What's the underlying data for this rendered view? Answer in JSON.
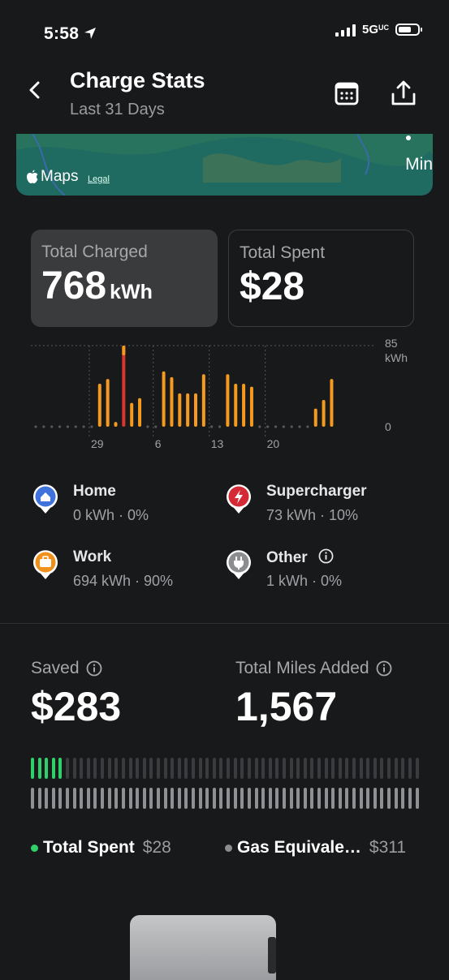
{
  "status_bar": {
    "time": "5:58",
    "network": "5G",
    "network_sup": "UC"
  },
  "header": {
    "title": "Charge Stats",
    "subtitle": "Last 31 Days"
  },
  "map": {
    "logo": "Maps",
    "legal": "Legal",
    "city_partial": "Min"
  },
  "stats": {
    "total_charged": {
      "label": "Total Charged",
      "value": "768",
      "unit": "kWh"
    },
    "total_spent": {
      "label": "Total Spent",
      "value": "$28"
    }
  },
  "chart_data": {
    "type": "bar",
    "ylabel": "kWh",
    "ylim": [
      0,
      85
    ],
    "y_ticks": [
      "85",
      "0"
    ],
    "y_top_unit": "kWh",
    "x_tick_labels": [
      "29",
      "6",
      "13",
      "20"
    ],
    "x_tick_indices": [
      7,
      15,
      22,
      29
    ],
    "values": [
      0,
      0,
      0,
      0,
      0,
      0,
      0,
      0,
      45,
      50,
      5,
      85,
      25,
      30,
      0,
      0,
      58,
      52,
      35,
      35,
      35,
      55,
      0,
      0,
      55,
      45,
      45,
      42,
      0,
      0,
      0,
      0,
      0,
      0,
      0,
      19,
      28,
      50
    ],
    "series_colors": [
      "#f49a1f",
      "#d9362f"
    ],
    "supercharger_indices": [
      11
    ]
  },
  "legend": {
    "home": {
      "name": "Home",
      "value": "0 kWh · 0%",
      "color": "#3f73db"
    },
    "supercharger": {
      "name": "Supercharger",
      "value": "73 kWh · 10%",
      "color": "#d42a35"
    },
    "work": {
      "name": "Work",
      "value": "694 kWh · 90%",
      "color": "#f0901c"
    },
    "other": {
      "name": "Other",
      "value": "1 kWh · 0%",
      "color": "#8b8d90"
    }
  },
  "savings": {
    "saved_label": "Saved",
    "saved_value": "$283",
    "miles_label": "Total Miles Added",
    "miles_value": "1,567",
    "spent_bar_fraction": 0.09,
    "gas_bar_fraction": 1.0
  },
  "footer": {
    "spent_label": "Total Spent",
    "spent_value": "$28",
    "spent_color": "#2fcf6a",
    "gas_label": "Gas Equivale…",
    "gas_value": "$311",
    "gas_color": "#8b8d90"
  }
}
